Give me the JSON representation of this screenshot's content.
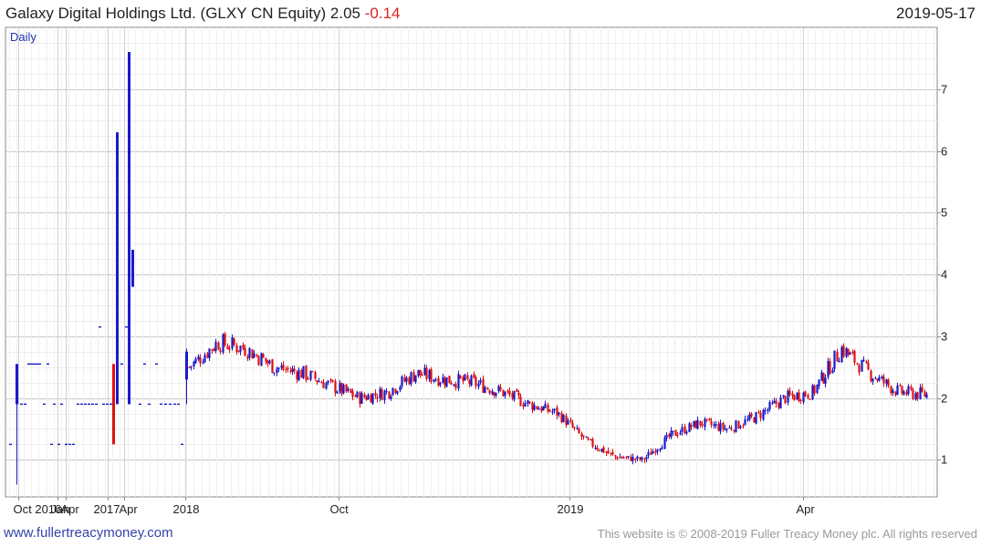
{
  "header": {
    "name": "Galaxy Digital Holdings Ltd. (GLXY CN Equity)",
    "price": "2.05",
    "change": "-0.14",
    "date": "2019-05-17"
  },
  "footer": {
    "site": "www.fullertreacymoney.com",
    "copyright": "This website is © 2008-2019 Fuller Treacy Money plc. All rights reserved"
  },
  "colors": {
    "up": "#1a1acc",
    "down": "#dd1111",
    "grid": "#d6d6d6",
    "axis": "#888888"
  },
  "chart_data": {
    "type": "candlestick",
    "period": "Daily",
    "ylim": [
      0.4,
      8.0
    ],
    "yticks": [
      "1",
      "2",
      "3",
      "4",
      "5",
      "6",
      "7"
    ],
    "xtick_labels": [
      "Oct 2016",
      "Jan",
      "Apr",
      "2017",
      "Apr",
      "2018",
      "Oct",
      "2019",
      "Apr"
    ],
    "grid": true,
    "early_bars": [
      {
        "open": 1.9,
        "close": 2.55,
        "low": 0.6,
        "high": 2.55
      },
      {
        "open": 2.55,
        "close": 1.25,
        "low": 1.25,
        "high": 2.55
      },
      {
        "open": 1.9,
        "close": 6.3,
        "low": 1.9,
        "high": 6.3
      },
      {
        "open": 1.9,
        "close": 7.6,
        "low": 1.9,
        "high": 7.6
      },
      {
        "open": 3.8,
        "close": 4.4,
        "low": 3.8,
        "high": 4.4
      },
      {
        "open": 2.3,
        "close": 2.75,
        "low": 1.9,
        "high": 2.8
      }
    ],
    "close_path": [
      {
        "date": "2018-01",
        "close": 2.5
      },
      {
        "date": "2018-01",
        "close": 2.9
      },
      {
        "date": "2018-02",
        "close": 2.8
      },
      {
        "date": "2018-03",
        "close": 2.5
      },
      {
        "date": "2018-04",
        "close": 2.4
      },
      {
        "date": "2018-05",
        "close": 2.2
      },
      {
        "date": "2018-06",
        "close": 2.0
      },
      {
        "date": "2018-07",
        "close": 2.1
      },
      {
        "date": "2018-08",
        "close": 2.4
      },
      {
        "date": "2018-09",
        "close": 2.3
      },
      {
        "date": "2018-10",
        "close": 2.25
      },
      {
        "date": "2018-10",
        "close": 2.1
      },
      {
        "date": "2018-11",
        "close": 1.9
      },
      {
        "date": "2018-11",
        "close": 1.75
      },
      {
        "date": "2018-12",
        "close": 1.3
      },
      {
        "date": "2018-12",
        "close": 1.05
      },
      {
        "date": "2019-01",
        "close": 1.0
      },
      {
        "date": "2019-01",
        "close": 1.4
      },
      {
        "date": "2019-02",
        "close": 1.6
      },
      {
        "date": "2019-02",
        "close": 1.5
      },
      {
        "date": "2019-03",
        "close": 1.7
      },
      {
        "date": "2019-03",
        "close": 2.0
      },
      {
        "date": "2019-04",
        "close": 2.1
      },
      {
        "date": "2019-04",
        "close": 2.8
      },
      {
        "date": "2019-04",
        "close": 2.4
      },
      {
        "date": "2019-05",
        "close": 2.1
      },
      {
        "date": "2019-05",
        "close": 2.05
      }
    ]
  }
}
